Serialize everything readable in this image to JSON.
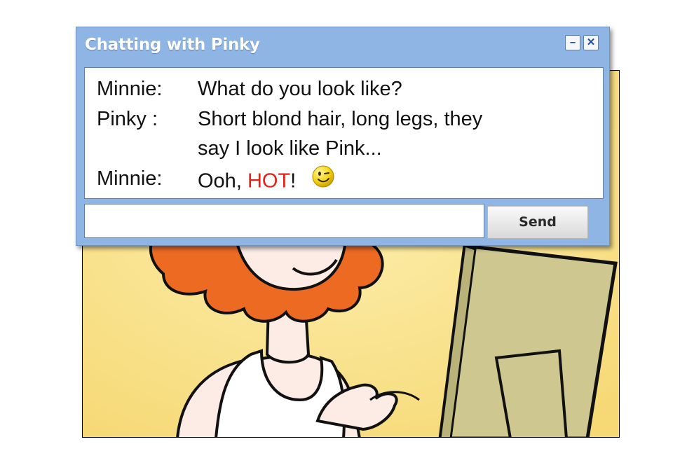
{
  "window": {
    "title": "Chatting with Pinky",
    "minimize_glyph": "–",
    "close_glyph": "✕"
  },
  "messages": [
    {
      "sender": "Minnie:",
      "text": "What do you look like?"
    },
    {
      "sender": "Pinky  :",
      "text": "Short blond hair, long legs, they",
      "text_cont": "say I look like Pink..."
    },
    {
      "sender": "Minnie:",
      "text_before": "Ooh, ",
      "text_hot": "HOT",
      "text_after": "!",
      "emoji": "winking-smiley-icon"
    }
  ],
  "input": {
    "value": ""
  },
  "send_label": "Send",
  "colors": {
    "hot": "#e2231a",
    "hair": "#ec6a22",
    "background": "#fbe27f",
    "monitor": "#cec890"
  }
}
